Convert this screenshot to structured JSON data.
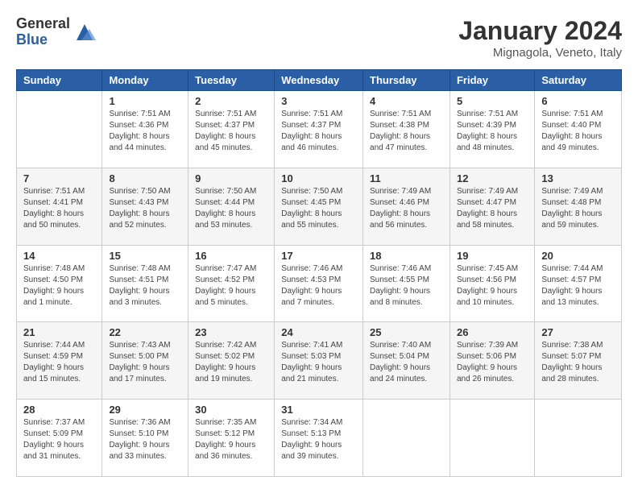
{
  "logo": {
    "general": "General",
    "blue": "Blue"
  },
  "title": "January 2024",
  "subtitle": "Mignagola, Veneto, Italy",
  "header_days": [
    "Sunday",
    "Monday",
    "Tuesday",
    "Wednesday",
    "Thursday",
    "Friday",
    "Saturday"
  ],
  "weeks": [
    [
      {
        "day": "",
        "sunrise": "",
        "sunset": "",
        "daylight": ""
      },
      {
        "day": "1",
        "sunrise": "Sunrise: 7:51 AM",
        "sunset": "Sunset: 4:36 PM",
        "daylight": "Daylight: 8 hours and 44 minutes."
      },
      {
        "day": "2",
        "sunrise": "Sunrise: 7:51 AM",
        "sunset": "Sunset: 4:37 PM",
        "daylight": "Daylight: 8 hours and 45 minutes."
      },
      {
        "day": "3",
        "sunrise": "Sunrise: 7:51 AM",
        "sunset": "Sunset: 4:37 PM",
        "daylight": "Daylight: 8 hours and 46 minutes."
      },
      {
        "day": "4",
        "sunrise": "Sunrise: 7:51 AM",
        "sunset": "Sunset: 4:38 PM",
        "daylight": "Daylight: 8 hours and 47 minutes."
      },
      {
        "day": "5",
        "sunrise": "Sunrise: 7:51 AM",
        "sunset": "Sunset: 4:39 PM",
        "daylight": "Daylight: 8 hours and 48 minutes."
      },
      {
        "day": "6",
        "sunrise": "Sunrise: 7:51 AM",
        "sunset": "Sunset: 4:40 PM",
        "daylight": "Daylight: 8 hours and 49 minutes."
      }
    ],
    [
      {
        "day": "7",
        "sunrise": "Sunrise: 7:51 AM",
        "sunset": "Sunset: 4:41 PM",
        "daylight": "Daylight: 8 hours and 50 minutes."
      },
      {
        "day": "8",
        "sunrise": "Sunrise: 7:50 AM",
        "sunset": "Sunset: 4:43 PM",
        "daylight": "Daylight: 8 hours and 52 minutes."
      },
      {
        "day": "9",
        "sunrise": "Sunrise: 7:50 AM",
        "sunset": "Sunset: 4:44 PM",
        "daylight": "Daylight: 8 hours and 53 minutes."
      },
      {
        "day": "10",
        "sunrise": "Sunrise: 7:50 AM",
        "sunset": "Sunset: 4:45 PM",
        "daylight": "Daylight: 8 hours and 55 minutes."
      },
      {
        "day": "11",
        "sunrise": "Sunrise: 7:49 AM",
        "sunset": "Sunset: 4:46 PM",
        "daylight": "Daylight: 8 hours and 56 minutes."
      },
      {
        "day": "12",
        "sunrise": "Sunrise: 7:49 AM",
        "sunset": "Sunset: 4:47 PM",
        "daylight": "Daylight: 8 hours and 58 minutes."
      },
      {
        "day": "13",
        "sunrise": "Sunrise: 7:49 AM",
        "sunset": "Sunset: 4:48 PM",
        "daylight": "Daylight: 8 hours and 59 minutes."
      }
    ],
    [
      {
        "day": "14",
        "sunrise": "Sunrise: 7:48 AM",
        "sunset": "Sunset: 4:50 PM",
        "daylight": "Daylight: 9 hours and 1 minute."
      },
      {
        "day": "15",
        "sunrise": "Sunrise: 7:48 AM",
        "sunset": "Sunset: 4:51 PM",
        "daylight": "Daylight: 9 hours and 3 minutes."
      },
      {
        "day": "16",
        "sunrise": "Sunrise: 7:47 AM",
        "sunset": "Sunset: 4:52 PM",
        "daylight": "Daylight: 9 hours and 5 minutes."
      },
      {
        "day": "17",
        "sunrise": "Sunrise: 7:46 AM",
        "sunset": "Sunset: 4:53 PM",
        "daylight": "Daylight: 9 hours and 7 minutes."
      },
      {
        "day": "18",
        "sunrise": "Sunrise: 7:46 AM",
        "sunset": "Sunset: 4:55 PM",
        "daylight": "Daylight: 9 hours and 8 minutes."
      },
      {
        "day": "19",
        "sunrise": "Sunrise: 7:45 AM",
        "sunset": "Sunset: 4:56 PM",
        "daylight": "Daylight: 9 hours and 10 minutes."
      },
      {
        "day": "20",
        "sunrise": "Sunrise: 7:44 AM",
        "sunset": "Sunset: 4:57 PM",
        "daylight": "Daylight: 9 hours and 13 minutes."
      }
    ],
    [
      {
        "day": "21",
        "sunrise": "Sunrise: 7:44 AM",
        "sunset": "Sunset: 4:59 PM",
        "daylight": "Daylight: 9 hours and 15 minutes."
      },
      {
        "day": "22",
        "sunrise": "Sunrise: 7:43 AM",
        "sunset": "Sunset: 5:00 PM",
        "daylight": "Daylight: 9 hours and 17 minutes."
      },
      {
        "day": "23",
        "sunrise": "Sunrise: 7:42 AM",
        "sunset": "Sunset: 5:02 PM",
        "daylight": "Daylight: 9 hours and 19 minutes."
      },
      {
        "day": "24",
        "sunrise": "Sunrise: 7:41 AM",
        "sunset": "Sunset: 5:03 PM",
        "daylight": "Daylight: 9 hours and 21 minutes."
      },
      {
        "day": "25",
        "sunrise": "Sunrise: 7:40 AM",
        "sunset": "Sunset: 5:04 PM",
        "daylight": "Daylight: 9 hours and 24 minutes."
      },
      {
        "day": "26",
        "sunrise": "Sunrise: 7:39 AM",
        "sunset": "Sunset: 5:06 PM",
        "daylight": "Daylight: 9 hours and 26 minutes."
      },
      {
        "day": "27",
        "sunrise": "Sunrise: 7:38 AM",
        "sunset": "Sunset: 5:07 PM",
        "daylight": "Daylight: 9 hours and 28 minutes."
      }
    ],
    [
      {
        "day": "28",
        "sunrise": "Sunrise: 7:37 AM",
        "sunset": "Sunset: 5:09 PM",
        "daylight": "Daylight: 9 hours and 31 minutes."
      },
      {
        "day": "29",
        "sunrise": "Sunrise: 7:36 AM",
        "sunset": "Sunset: 5:10 PM",
        "daylight": "Daylight: 9 hours and 33 minutes."
      },
      {
        "day": "30",
        "sunrise": "Sunrise: 7:35 AM",
        "sunset": "Sunset: 5:12 PM",
        "daylight": "Daylight: 9 hours and 36 minutes."
      },
      {
        "day": "31",
        "sunrise": "Sunrise: 7:34 AM",
        "sunset": "Sunset: 5:13 PM",
        "daylight": "Daylight: 9 hours and 39 minutes."
      },
      {
        "day": "",
        "sunrise": "",
        "sunset": "",
        "daylight": ""
      },
      {
        "day": "",
        "sunrise": "",
        "sunset": "",
        "daylight": ""
      },
      {
        "day": "",
        "sunrise": "",
        "sunset": "",
        "daylight": ""
      }
    ]
  ]
}
